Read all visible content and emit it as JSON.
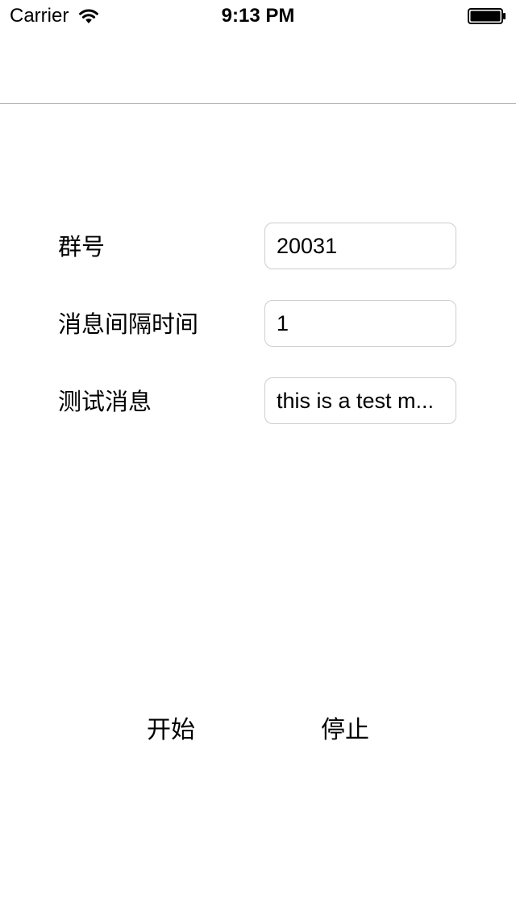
{
  "status_bar": {
    "carrier": "Carrier",
    "time": "9:13 PM",
    "wifi_icon": "wifi-icon",
    "battery_icon": "battery-icon",
    "battery_level": 1.0
  },
  "form": {
    "group_label": "群号",
    "group_value": "20031",
    "interval_label": "消息间隔时间",
    "interval_value": "1",
    "message_label": "测试消息",
    "message_value": "this is a test m..."
  },
  "actions": {
    "start_label": "开始",
    "stop_label": "停止"
  }
}
